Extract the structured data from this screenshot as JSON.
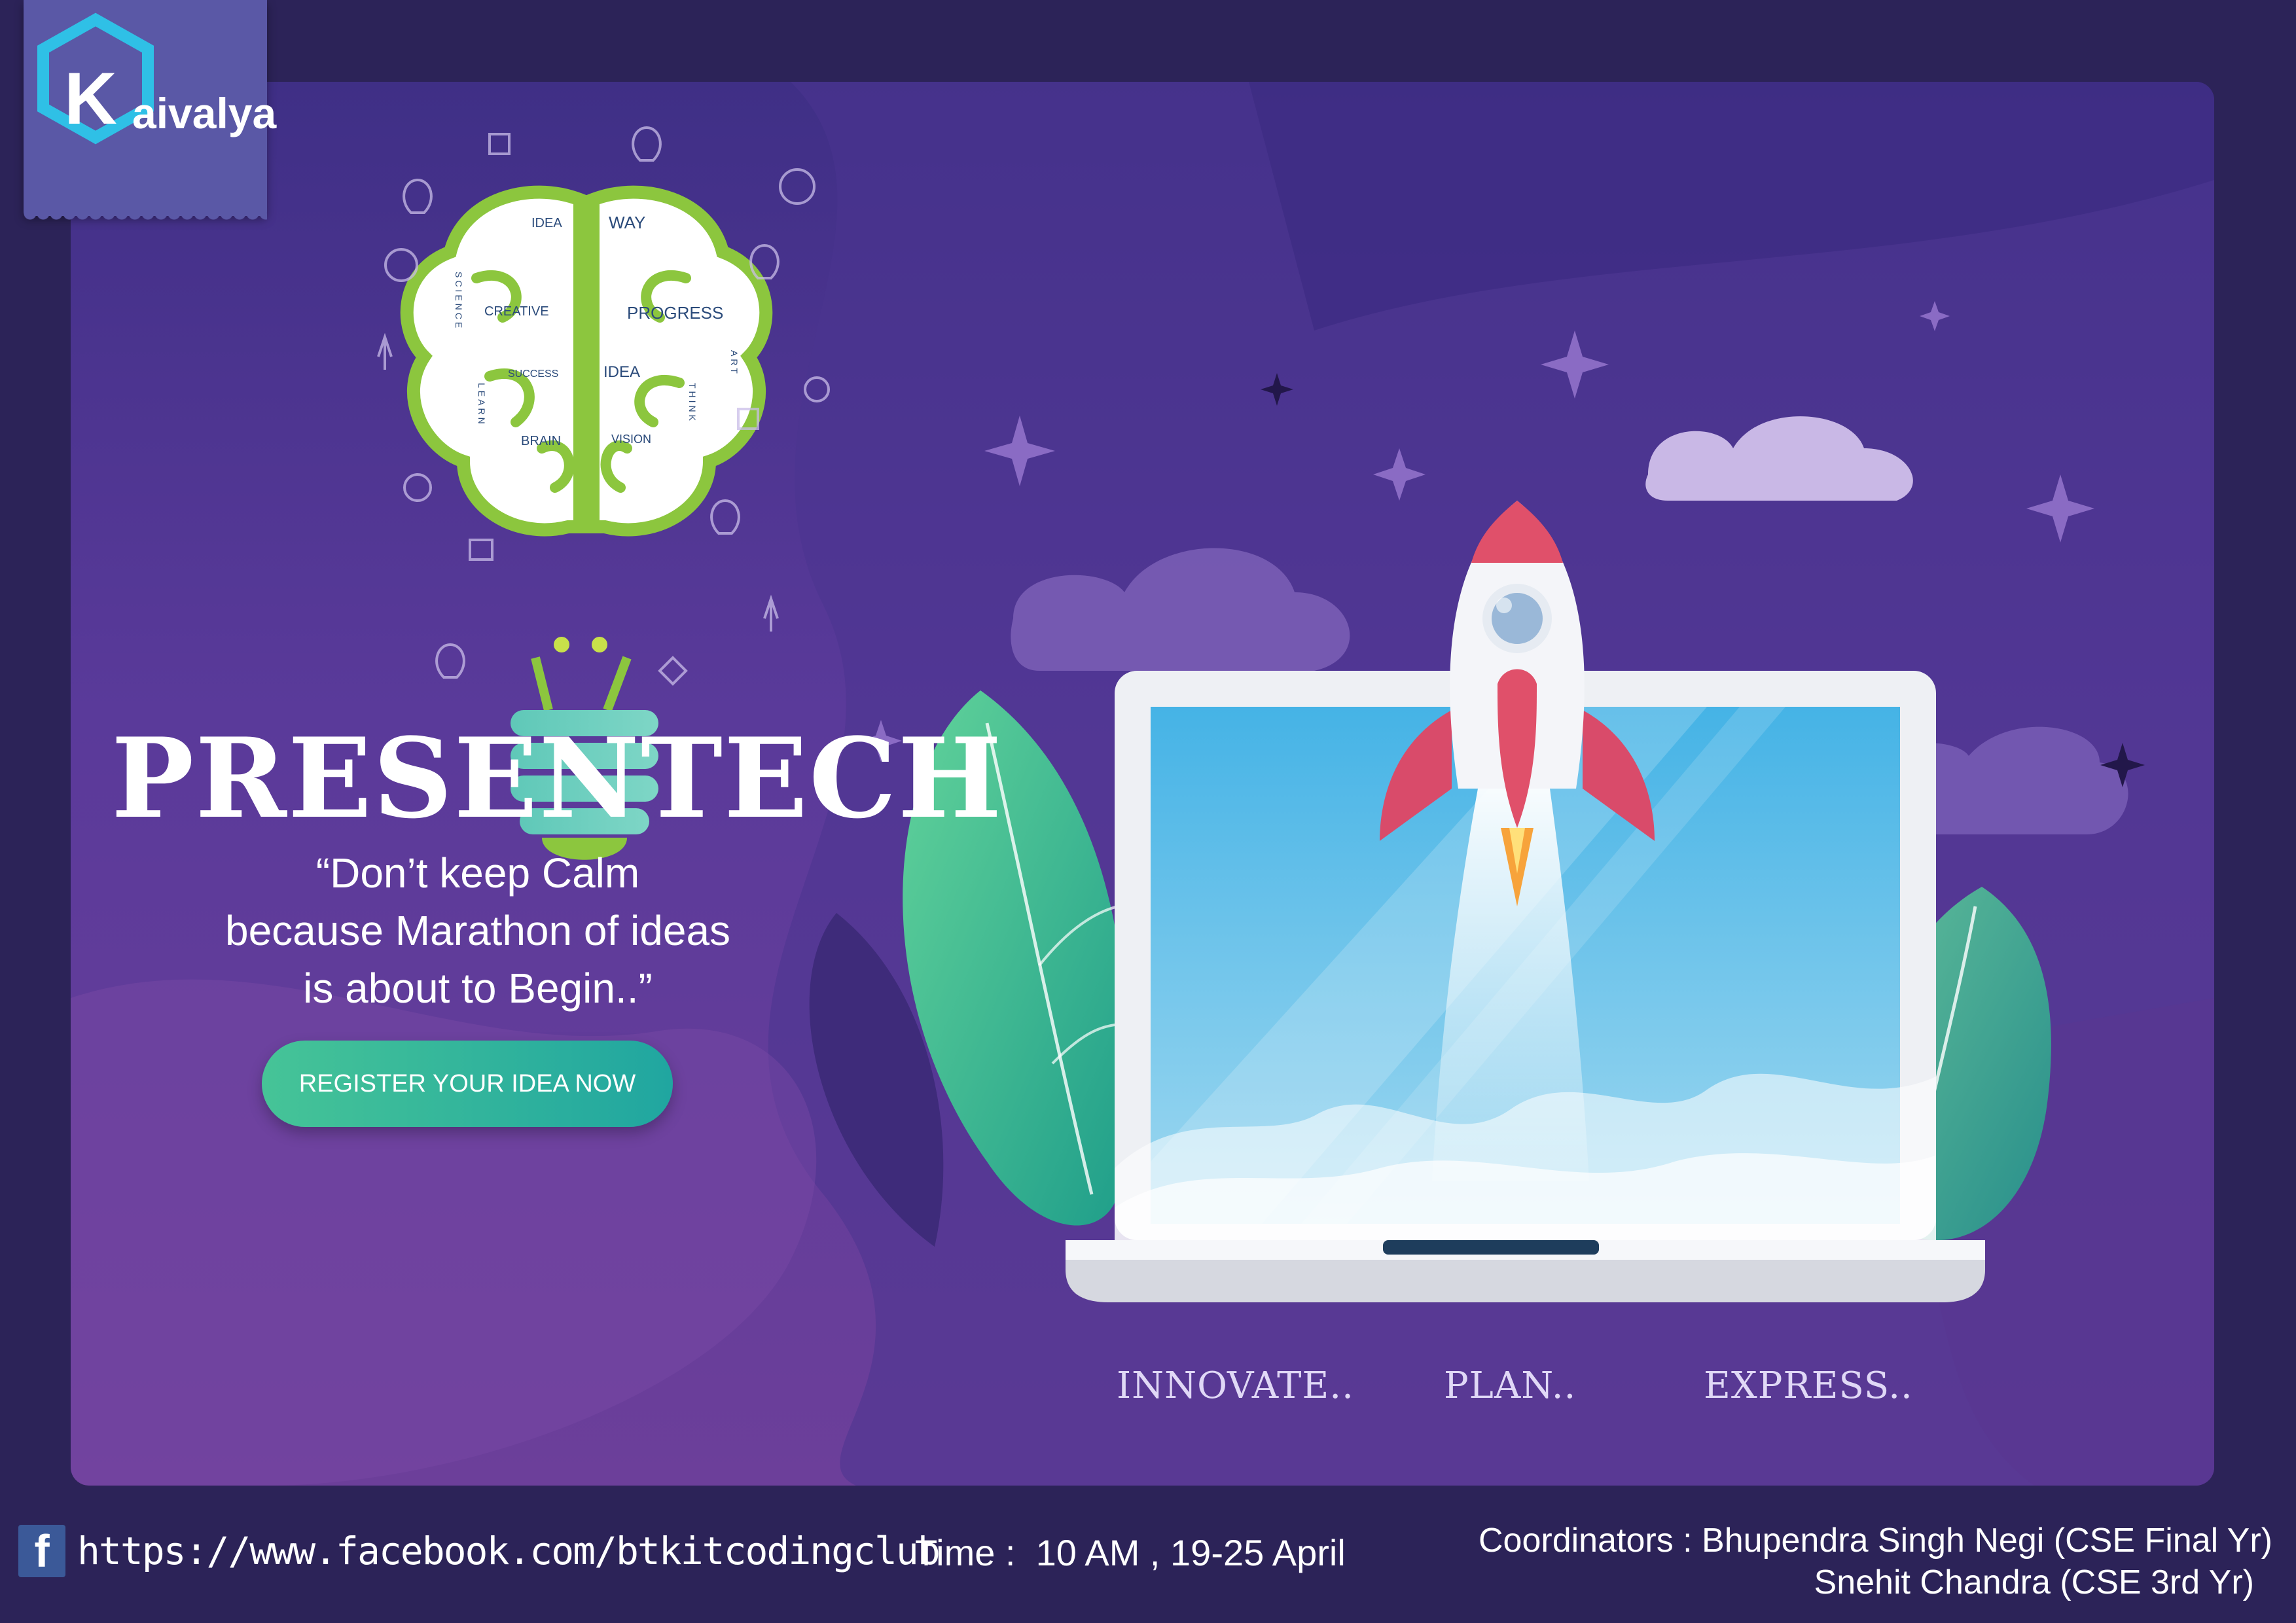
{
  "brand": {
    "name": "aivalya",
    "initial": "K"
  },
  "hero": {
    "title": "PRESENTECH",
    "quote_lines": [
      "“Don’t keep Calm",
      "because Marathon of ideas",
      "is about to Begin..”"
    ],
    "cta_label": "REGISTER YOUR IDEA NOW"
  },
  "brain_words": [
    "IDEA",
    "WAY",
    "SCIENCE",
    "CREATIVE",
    "PROGRESS",
    "ART",
    "SUCCESS",
    "IDEA",
    "LEARN",
    "THINK",
    "BRAIN",
    "VISION"
  ],
  "taglines": [
    "INNOVATE..",
    "PLAN..",
    "EXPRESS.."
  ],
  "footer": {
    "facebook_icon": "facebook-icon",
    "url": "https://www.facebook.com/btkitcodingclub",
    "time": "Time :  10 AM , 19-25 April",
    "coordinators_line1": "Coordinators : Bhupendra Singh Negi (CSE Final Yr)",
    "coordinators_line2": "Snehit Chandra (CSE 3rd Yr)"
  },
  "colors": {
    "background": "#2c2358",
    "panel_top": "#3f2f86",
    "panel_bottom": "#6c3f9a",
    "leaf_green": "#4cc28e",
    "brain_green": "#8cc63e",
    "rocket_red": "#e0506a",
    "screen_blue": "#5ab9e8"
  }
}
